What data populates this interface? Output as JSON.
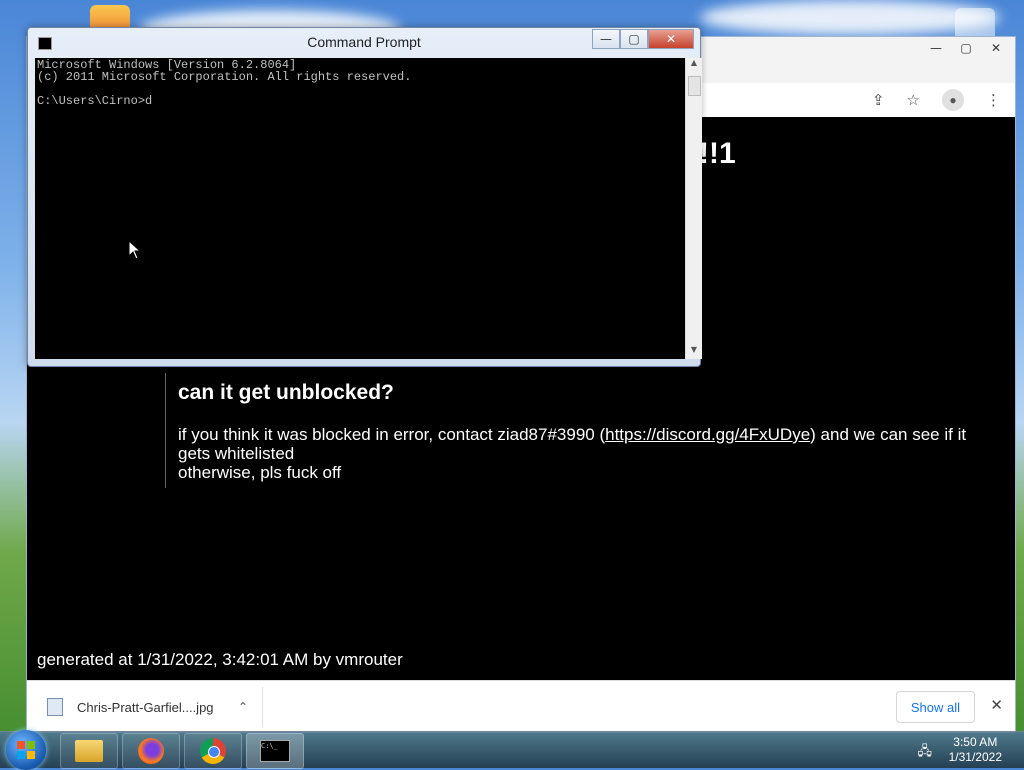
{
  "cmd": {
    "title": "Command Prompt",
    "lines": [
      "Microsoft Windows [Version 6.2.8064]",
      "(c) 2011 Microsoft Corporation. All rights reserved.",
      "",
      "C:\\Users\\Cirno>d"
    ],
    "controls": {
      "minimize": "—",
      "maximize": "▢",
      "close": "✕"
    }
  },
  "browser": {
    "controls": {
      "minimize": "—",
      "maximize": "▢",
      "close": "✕"
    },
    "toolbar_icons": [
      "share-icon",
      "star-icon",
      "profile-icon",
      "menu-icon"
    ],
    "page": {
      "heading_fragment": "!!1",
      "section_title": "can it get unblocked?",
      "body_line1_prefix": "if you think it was blocked in error, contact ziad87#3990 (",
      "body_link": "https://discord.gg/4FxUDye",
      "body_line1_suffix": ") and we can see if it gets whitelisted",
      "body_line2": "otherwise, pls fuck off",
      "generated": "generated at 1/31/2022, 3:42:01 AM by vmrouter"
    },
    "downloads": {
      "file_name": "Chris-Pratt-Garfiel....jpg",
      "show_all": "Show all"
    }
  },
  "taskbar": {
    "apps": [
      "explorer-icon",
      "firefox-icon",
      "chrome-icon",
      "cmd-icon"
    ],
    "time": "3:50 AM",
    "date": "1/31/2022"
  },
  "colors": {
    "page_bg": "#000000",
    "link": "#ffffff",
    "show_all": "#1a73e8",
    "cmd_text": "#c0c0c0"
  }
}
